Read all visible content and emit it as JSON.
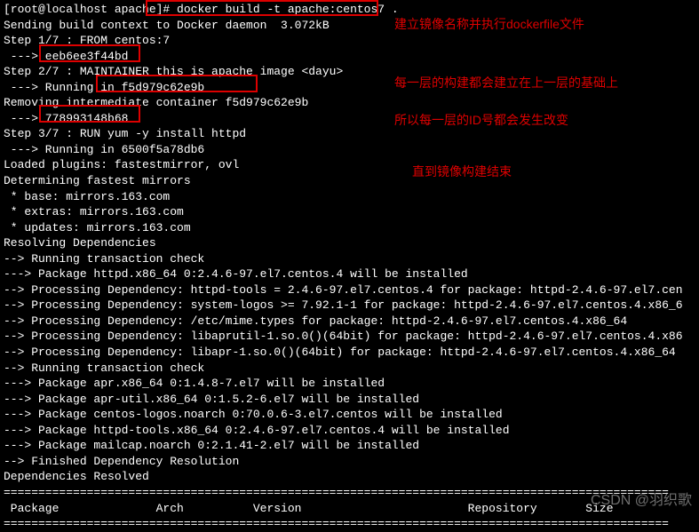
{
  "prompt": "[root@localhost apache]# ",
  "command": "docker build -t apache:centos7 .",
  "lines": {
    "l01": "Sending build context to Docker daemon  3.072kB",
    "l02": "Step 1/7 : FROM centos:7",
    "l03": " ---> eeb6ee3f44bd",
    "l04": "Step 2/7 : MAINTAINER this is apache image <dayu>",
    "l05": " ---> Running in f5d979c62e9b",
    "l06": "Removing intermediate container f5d979c62e9b",
    "l07": " ---> 778993148b68",
    "l08": "Step 3/7 : RUN yum -y install httpd",
    "l09": " ---> Running in 6500f5a78db6",
    "l10": "Loaded plugins: fastestmirror, ovl",
    "l11": "Determining fastest mirrors",
    "l12": " * base: mirrors.163.com",
    "l13": " * extras: mirrors.163.com",
    "l14": " * updates: mirrors.163.com",
    "l15": "Resolving Dependencies",
    "l16": "--> Running transaction check",
    "l17": "---> Package httpd.x86_64 0:2.4.6-97.el7.centos.4 will be installed",
    "l18": "--> Processing Dependency: httpd-tools = 2.4.6-97.el7.centos.4 for package: httpd-2.4.6-97.el7.cen",
    "l19": "--> Processing Dependency: system-logos >= 7.92.1-1 for package: httpd-2.4.6-97.el7.centos.4.x86_6",
    "l20": "--> Processing Dependency: /etc/mime.types for package: httpd-2.4.6-97.el7.centos.4.x86_64",
    "l21": "--> Processing Dependency: libaprutil-1.so.0()(64bit) for package: httpd-2.4.6-97.el7.centos.4.x86",
    "l22": "--> Processing Dependency: libapr-1.so.0()(64bit) for package: httpd-2.4.6-97.el7.centos.4.x86_64",
    "l23": "--> Running transaction check",
    "l24": "---> Package apr.x86_64 0:1.4.8-7.el7 will be installed",
    "l25": "---> Package apr-util.x86_64 0:1.5.2-6.el7 will be installed",
    "l26": "---> Package centos-logos.noarch 0:70.0.6-3.el7.centos will be installed",
    "l27": "---> Package httpd-tools.x86_64 0:2.4.6-97.el7.centos.4 will be installed",
    "l28": "---> Package mailcap.noarch 0:2.1.41-2.el7 will be installed",
    "l29": "--> Finished Dependency Resolution",
    "l30": "",
    "l31": "Dependencies Resolved",
    "l32": ""
  },
  "divider": "================================================================================================",
  "header": " Package              Arch          Version                        Repository       Size",
  "divider2": "================================================================================================",
  "annotations": {
    "a1": "建立镜像名称并执行dockerfile文件",
    "a2": "每一层的构建都会建立在上一层的基础上",
    "a3": "所以每一层的ID号都会发生改变",
    "a4": "直到镜像构建结束"
  },
  "watermark": "CSDN @羽织歌"
}
